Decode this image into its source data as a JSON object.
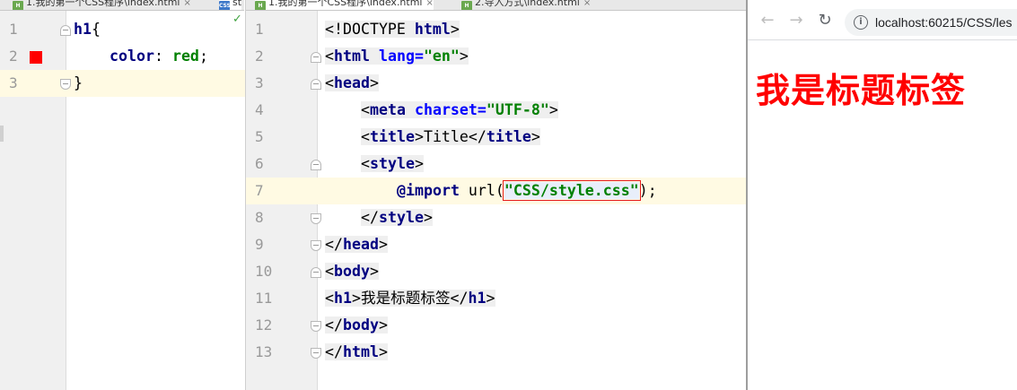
{
  "tabs": [
    {
      "label": "1.我的第一个CSS程序\\index.html",
      "icon": "html-file-icon",
      "badge": "H"
    },
    {
      "label": "st",
      "icon": "css-file-icon",
      "badge": "CSS"
    },
    {
      "label": "1.我的第一个CSS程序\\index.html",
      "icon": "html-file-icon",
      "badge": "H"
    },
    {
      "label": "2.导入方式\\index.html",
      "icon": "html-file-icon",
      "badge": "H"
    }
  ],
  "close_glyph": "×",
  "css_editor": {
    "line_numbers": [
      "1",
      "2",
      "3"
    ],
    "lines": [
      {
        "selector": "h1",
        "open": "{"
      },
      {
        "property": "color",
        "colon": ":",
        "value": "red",
        "semi": ";"
      },
      {
        "close": "}"
      }
    ],
    "check_glyph": "✓"
  },
  "html_editor": {
    "line_numbers": [
      "1",
      "2",
      "3",
      "4",
      "5",
      "6",
      "7",
      "8",
      "9",
      "10",
      "11",
      "12",
      "13"
    ],
    "doctype": "<!DOCTYPE ",
    "doctype_html": "html",
    "gt": ">",
    "lt": "<",
    "lt_slash": "</",
    "eq": "=",
    "tag_html": "html",
    "attr_lang": "lang",
    "val_lang": "\"en\"",
    "tag_head": "head",
    "tag_meta": "meta",
    "attr_charset": "charset",
    "val_charset": "\"UTF-8\"",
    "tag_title": "title",
    "title_text": "Title",
    "tag_style": "style",
    "at_import": "@import",
    "url_fn": " url(",
    "import_path": "\"CSS/style.css\"",
    "url_close": ");",
    "tag_body": "body",
    "tag_h1": "h1",
    "h1_text": "我是标题标签"
  },
  "browser": {
    "back": "←",
    "forward": "→",
    "reload": "↻",
    "info": "i",
    "url": "localhost:60215/CSS/les",
    "heading": "我是标题标签",
    "heading_color": "#ff0000"
  },
  "colors": {
    "error_marker": "#ff0000",
    "current_line": "#fffae3",
    "highlight_box": "#e51c1c"
  }
}
